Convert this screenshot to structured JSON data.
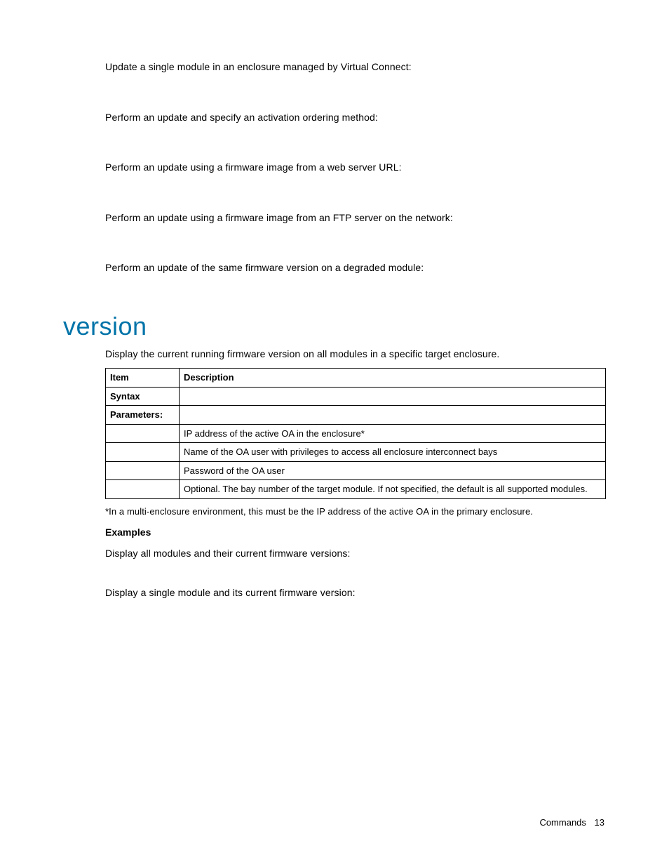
{
  "paragraphs": {
    "p1": "Update a single module in an enclosure managed by Virtual Connect:",
    "p2": "Perform an update and specify an activation ordering method:",
    "p3": "Perform an update using a firmware image from a web server URL:",
    "p4": "Perform an update using a firmware image from an FTP server on the network:",
    "p5": "Perform an update of the same firmware version on a degraded module:"
  },
  "section": {
    "heading": "version",
    "intro": "Display the current running firmware version on all modules in a specific target enclosure.",
    "table": {
      "header": {
        "col1": "Item",
        "col2": "Description"
      },
      "rows": [
        {
          "item": "Syntax",
          "desc": "",
          "bold": true
        },
        {
          "item": "Parameters:",
          "desc": "",
          "bold": true
        },
        {
          "item": "",
          "desc": "IP address of the active OA in the enclosure*",
          "bold": false
        },
        {
          "item": "",
          "desc": "Name of the OA user with privileges to access all enclosure interconnect bays",
          "bold": false
        },
        {
          "item": "",
          "desc": "Password of the OA user",
          "bold": false
        },
        {
          "item": "",
          "desc": "Optional. The bay number of the target module. If not specified, the default is all supported modules.",
          "bold": false
        }
      ]
    },
    "footnote": "*In a multi-enclosure environment, this must be the IP address of the active OA in the primary enclosure.",
    "examples_label": "Examples",
    "examples": {
      "e1": "Display all modules and their current firmware versions:",
      "e2": "Display a single module and its current firmware version:"
    }
  },
  "footer": {
    "section_name": "Commands",
    "page_number": "13"
  }
}
